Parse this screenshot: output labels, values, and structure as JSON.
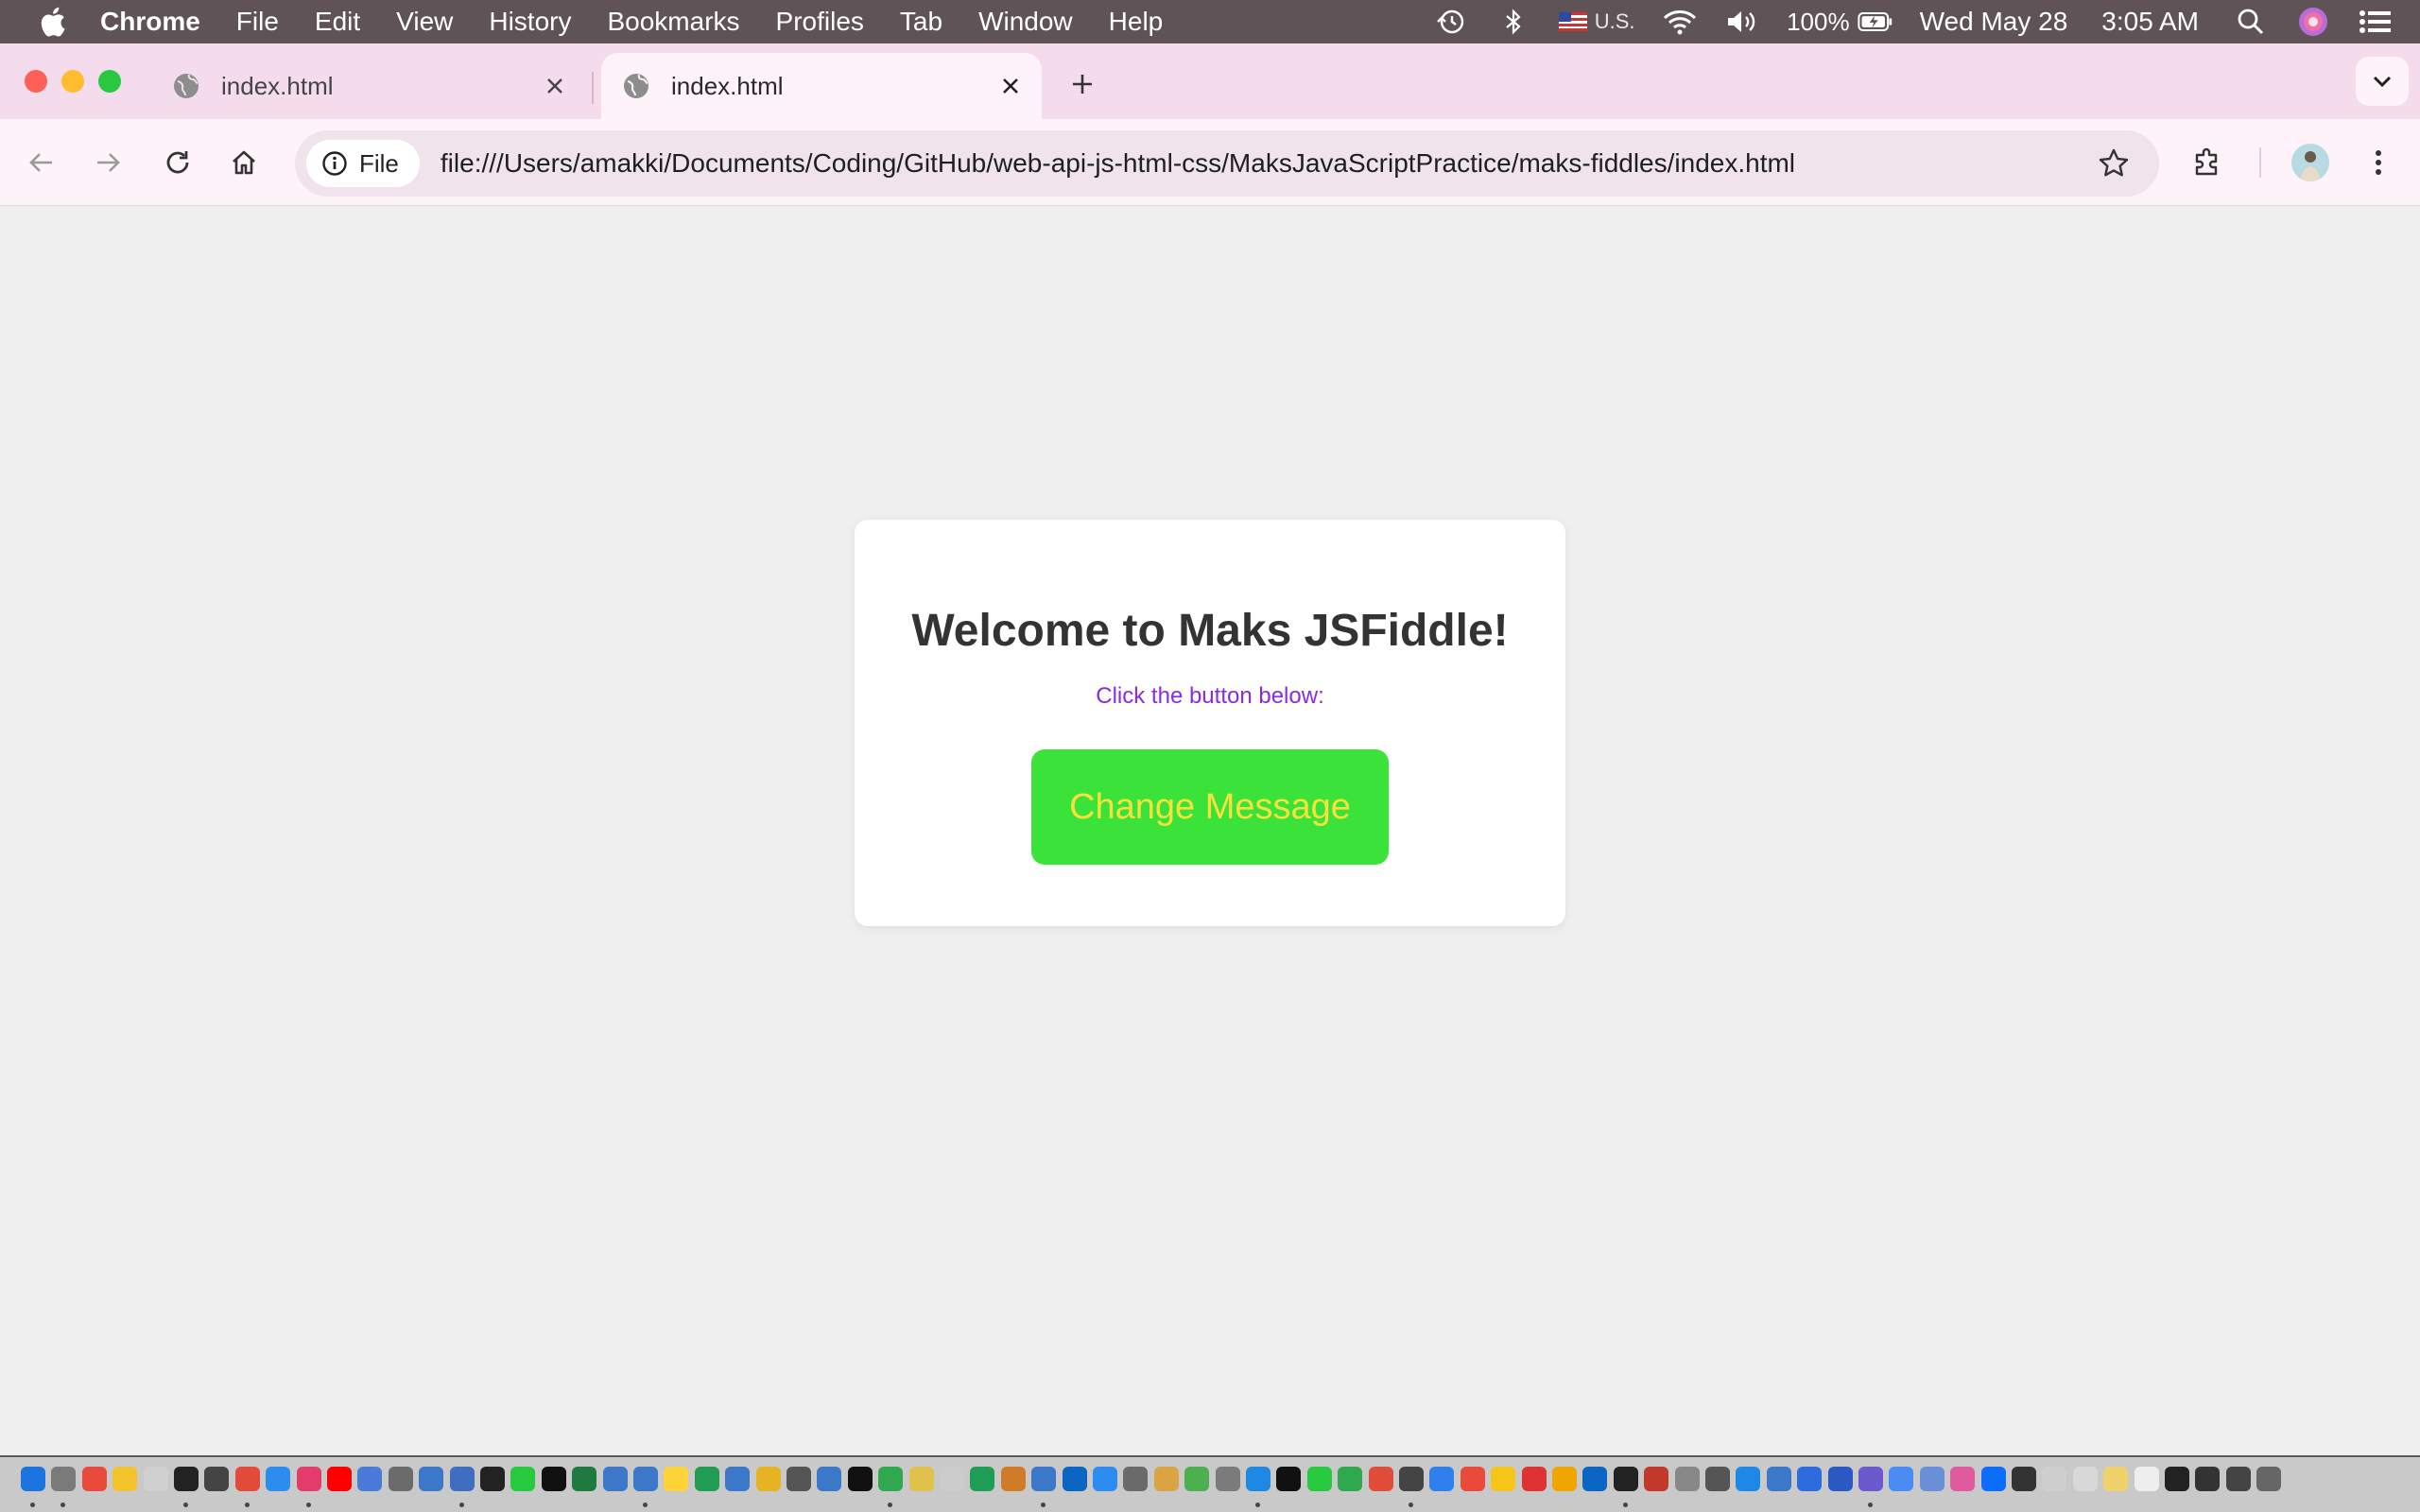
{
  "menubar": {
    "app_name": "Chrome",
    "items": [
      "File",
      "Edit",
      "View",
      "History",
      "Bookmarks",
      "Profiles",
      "Tab",
      "Window",
      "Help"
    ],
    "keyboard_layout": "U.S.",
    "battery": "100%",
    "date": "Wed May 28",
    "time": "3:05 AM"
  },
  "tabs": [
    {
      "title": "index.html",
      "active": false
    },
    {
      "title": "index.html",
      "active": true
    }
  ],
  "omnibox": {
    "chip_label": "File",
    "url": "file:///Users/amakki/Documents/Coding/GitHub/web-api-js-html-css/MaksJavaScriptPractice/maks-fiddles/index.html"
  },
  "page": {
    "heading": "Welcome to Maks JSFiddle!",
    "subtext": "Click the button below:",
    "button_label": "Change Message"
  },
  "colors": {
    "heading": "#333333",
    "subtext": "#8a2be2",
    "button_bg": "#3be23a",
    "button_text": "#f6e23a",
    "page_bg": "#efefef",
    "tabstrip_bg": "#f5dcec"
  },
  "dock": {
    "icon_colors": [
      "#1d74e0",
      "#7a7a7a",
      "#e94a3c",
      "#f3c32b",
      "#d0d0d0",
      "#222222",
      "#444444",
      "#e24b3a",
      "#2d8cf0",
      "#e13c6a",
      "#ff0000",
      "#4a7bd8",
      "#6b6b6b",
      "#3b78c9",
      "#3f6dbf",
      "#222222",
      "#27c93f",
      "#111111",
      "#1f7a3f",
      "#3b78c9",
      "#3b78c9",
      "#ffd43b",
      "#1f9d55",
      "#3b78c9",
      "#e6b422",
      "#555555",
      "#3b78c9",
      "#111111",
      "#2fa84f",
      "#e0c14c",
      "#cccccc",
      "#1f9d55",
      "#d07b2a",
      "#3b78c9",
      "#0a66c2",
      "#2d8cf0",
      "#6a6a6a",
      "#d9a441",
      "#4caf50",
      "#7b7b7b",
      "#1e88e5",
      "#111111",
      "#27c93f",
      "#2fa84f",
      "#e04e39",
      "#444444",
      "#2f80ed",
      "#e94a3c",
      "#f5c518",
      "#d33",
      "#f0a500",
      "#0a66c2",
      "#222222",
      "#c0392b",
      "#888888",
      "#555555",
      "#1e88e5",
      "#3b78c9",
      "#2d6cdf",
      "#2b59c3",
      "#6a5acd",
      "#4b8bf4",
      "#6b8fd6",
      "#e05aa0",
      "#0d6efd",
      "#333333",
      "#cfcfcf",
      "#d8d8d8",
      "#f0d26a",
      "#eeeeee",
      "#222222",
      "#333333",
      "#444444",
      "#666666"
    ]
  }
}
